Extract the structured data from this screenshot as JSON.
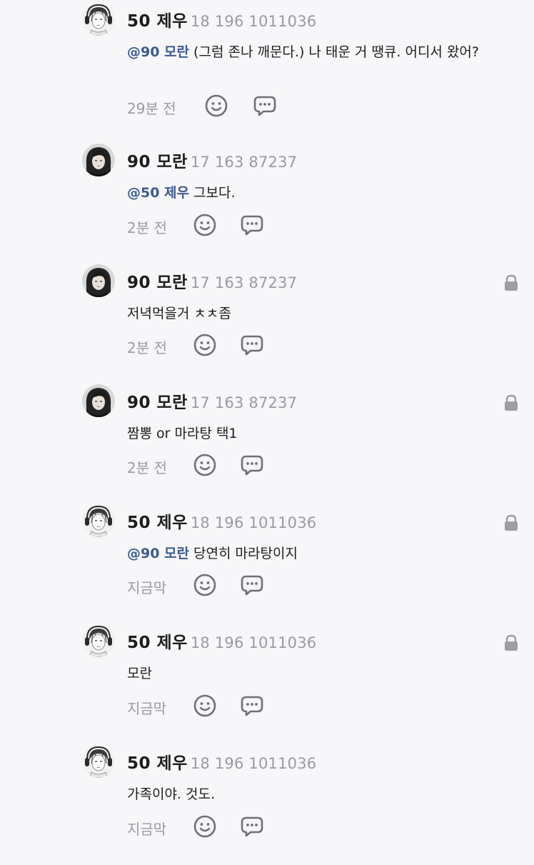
{
  "comments": [
    {
      "author": "50 제우",
      "meta": "18 196 1011036",
      "mention": "@90 모란",
      "text": " (그럼 존나 깨문다.) 나 태운 거 땡큐. 어디서 왔어?",
      "time": "29분 전",
      "avatar": "avatar-jewoo",
      "locked": false
    },
    {
      "author": "90 모란",
      "meta": "17 163 87237",
      "mention": "@50 제우",
      "text": " 그보다.",
      "time": "2분 전",
      "avatar": "avatar-moran",
      "locked": false
    },
    {
      "author": "90 모란",
      "meta": "17 163 87237",
      "mention": "",
      "text": "저녁먹을거 ㅊㅊ좀",
      "time": "2분 전",
      "avatar": "avatar-moran",
      "locked": true
    },
    {
      "author": "90 모란",
      "meta": "17 163 87237",
      "mention": "",
      "text": "짬뽕 or 마라탕 택1",
      "time": "2분 전",
      "avatar": "avatar-moran",
      "locked": true
    },
    {
      "author": "50 제우",
      "meta": "18 196 1011036",
      "mention": "@90 모란",
      "text": " 당연히 마라탕이지",
      "time": "지금막",
      "avatar": "avatar-jewoo",
      "locked": true
    },
    {
      "author": "50 제우",
      "meta": "18 196 1011036",
      "mention": "",
      "text": "모란",
      "time": "지금막",
      "avatar": "avatar-jewoo",
      "locked": true
    },
    {
      "author": "50 제우",
      "meta": "18 196 1011036",
      "mention": "",
      "text": "가족이야. 것도.",
      "time": "지금막",
      "avatar": "avatar-jewoo",
      "locked": false
    }
  ],
  "icons": {
    "react": "smiley-icon",
    "reply": "chat-bubble-icon",
    "lock": "lock-icon"
  },
  "colors": {
    "background": "#f7f7f9",
    "mention": "#3b5b8f",
    "muted": "#9a9aa0",
    "text": "#1d1d1f"
  }
}
